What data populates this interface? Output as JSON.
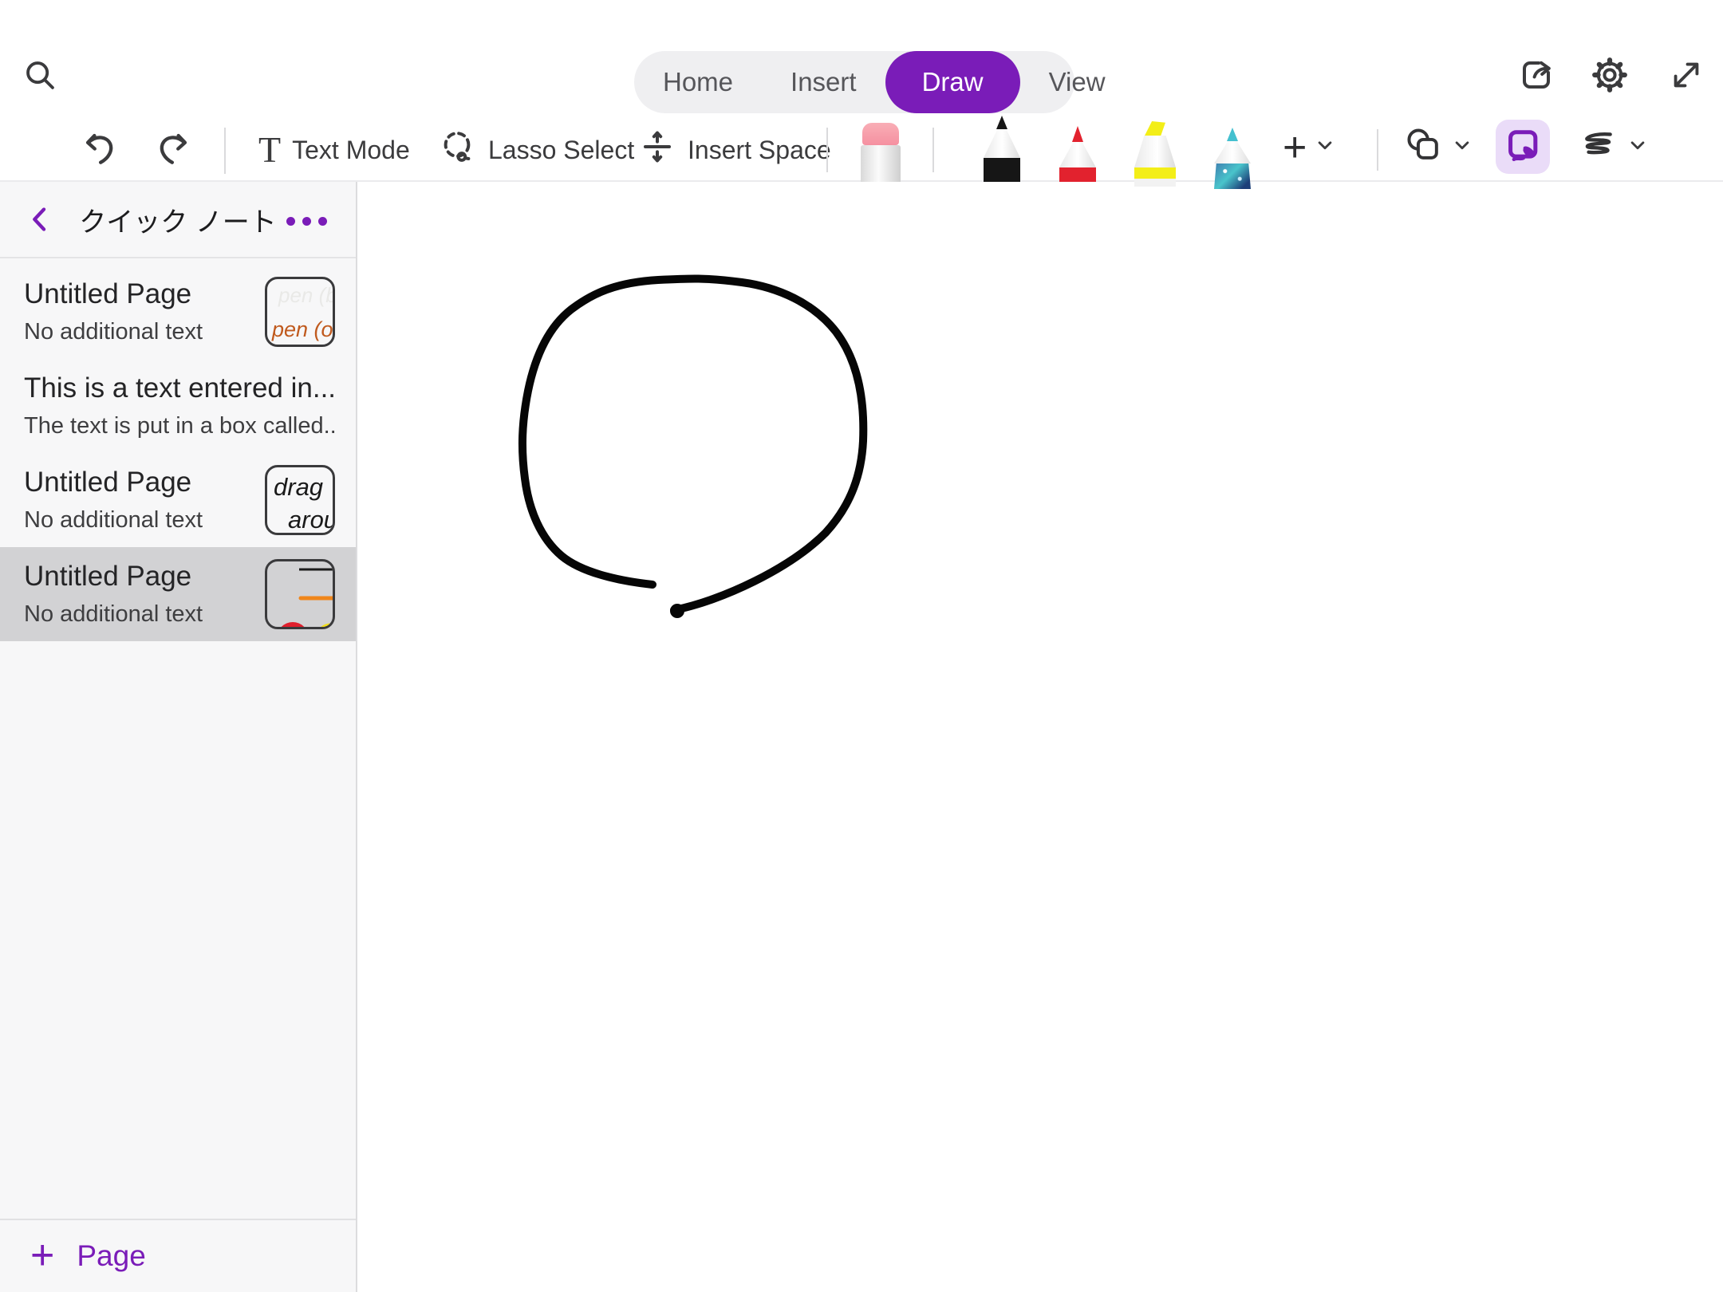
{
  "top_bar": {
    "search_icon": "search",
    "tabs": [
      {
        "label": "Home",
        "active": false
      },
      {
        "label": "Insert",
        "active": false
      },
      {
        "label": "Draw",
        "active": true
      },
      {
        "label": "View",
        "active": false
      }
    ],
    "right_icons": [
      "share",
      "settings",
      "expand"
    ]
  },
  "toolbar": {
    "text_mode_label": "Text Mode",
    "lasso_label": "Lasso Select",
    "insert_space_label": "Insert Space",
    "add_pen_label": "+",
    "tools": [
      "undo",
      "redo",
      "text-mode",
      "lasso-select",
      "insert-space",
      "eraser",
      "black-pen",
      "red-pen",
      "yellow-highlighter",
      "galaxy-pen",
      "add-pen",
      "shapes",
      "ink-note",
      "ink-to-shape"
    ],
    "colors": {
      "accent_purple": "#7A1CB8",
      "active_tool_bg": "#EADCF8",
      "eraser_pink": "#F59AA6",
      "pen_black": "#161616",
      "pen_red": "#E2222E",
      "highlighter_yellow": "#F3EE18",
      "galaxy_teal": "#43C0CF"
    }
  },
  "sidebar": {
    "title": "クイック ノート",
    "pages": [
      {
        "title": "Untitled Page",
        "subtitle": "No additional text",
        "selected": false,
        "thumbnail_text_line1": "pen (bl",
        "thumbnail_text_line2": "pen (ora"
      },
      {
        "title": "This is a text entered in...",
        "subtitle": "The text is put in a box called...",
        "selected": false
      },
      {
        "title": "Untitled Page",
        "subtitle": "No additional text",
        "selected": false,
        "thumbnail_text_line1": "drag",
        "thumbnail_text_line2": "arou"
      },
      {
        "title": "Untitled Page",
        "subtitle": "No additional text",
        "selected": true
      }
    ],
    "add_page_label": "Page"
  },
  "canvas": {
    "content": "hand-drawn black circle, open at bottom left of its base",
    "stroke_color": "#000000"
  }
}
